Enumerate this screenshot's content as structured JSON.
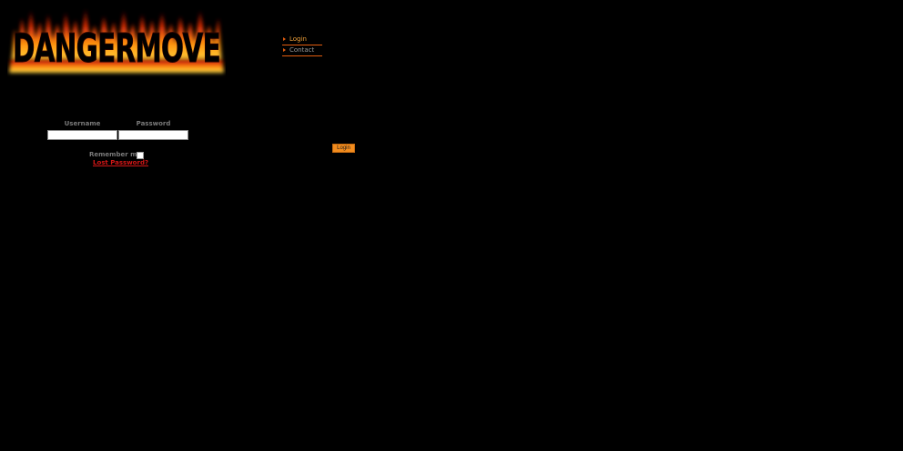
{
  "header": {
    "logo_text": "DANGERMOVE"
  },
  "nav": {
    "items": [
      {
        "label": "Login",
        "active": true
      },
      {
        "label": "Contact",
        "active": false
      }
    ]
  },
  "login_form": {
    "username_label": "Username",
    "username_value": "",
    "password_label": "Password",
    "password_value": "",
    "remember_label": "Remember me",
    "remember_checked": false,
    "lost_password_label": "Lost Password?",
    "submit_label": "Login"
  },
  "colors": {
    "background": "#000000",
    "accent": "#f28c1e",
    "link_red": "#d21616"
  }
}
